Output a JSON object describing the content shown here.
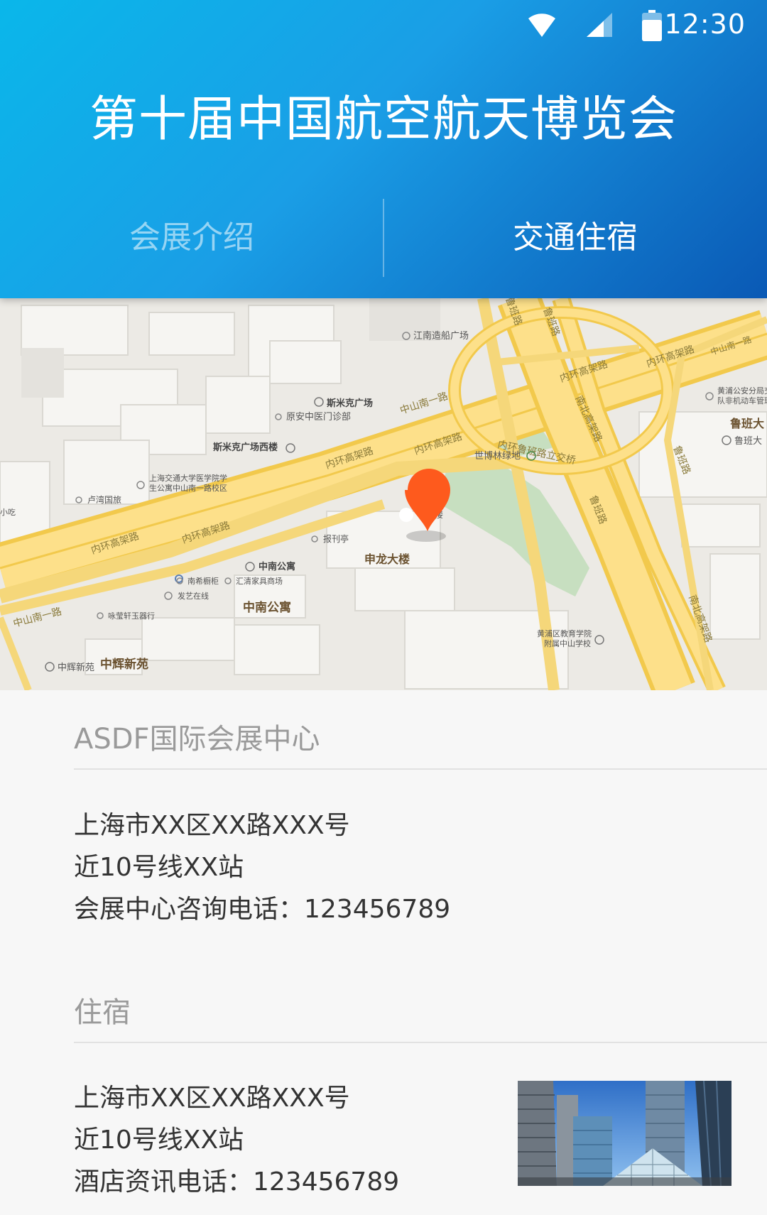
{
  "status_bar": {
    "time": "12:30",
    "icons": [
      "wifi-icon",
      "signal-icon",
      "battery-icon"
    ]
  },
  "header": {
    "title": "第十届中国航空航天博览会",
    "tabs": [
      {
        "label": "会展介绍",
        "active": false
      },
      {
        "label": "交通住宿",
        "active": true
      }
    ]
  },
  "map": {
    "marker_icon": "location-pin-icon",
    "marker_color": "#fe5a1d",
    "labels": {
      "a": "江南造船广场",
      "b": "斯米克广场",
      "c": "原安中医门诊部",
      "d": "斯米克广场西楼",
      "e": "上海交通大学医学院学",
      "e2": "生公寓中山南一路校区",
      "f": "卢湾国旅",
      "g": "小吃",
      "h": "报刊亭",
      "i": "中南公寓",
      "j": "南希橱柜",
      "k": "汇清家具商场",
      "l": "发艺在线",
      "m": "咏莹轩玉器行",
      "n": "中南公寓",
      "o": "中辉新苑",
      "p": "中辉新苑",
      "q": "申龙大楼",
      "q2": "大楼",
      "r": "世博林绿地",
      "s": "内环鲁班路立交桥",
      "t": "黄浦区教育学院",
      "t2": "附属中山学校",
      "u": "黄浦公安分局交",
      "u2": "队非机动车管理",
      "v": "鲁班大",
      "w": "鲁班大",
      "road_a": "中山南一路",
      "road_b": "中山南一路",
      "road_c": "中山南一路",
      "road_d": "内环高架路",
      "road_e": "内环高架路",
      "road_f": "内环高架路",
      "road_g": "内环高架路",
      "road_h": "内环高架路",
      "road_i": "内环高架路",
      "road_j": "南北高架路",
      "road_k": "南北高架路",
      "road_l": "鲁班路",
      "road_m": "鲁班路",
      "road_n": "鲁班路",
      "road_o": "鲁班路"
    }
  },
  "venue": {
    "title": "ASDF国际会展中心",
    "address": "上海市XX区XX路XXX号",
    "station": "近10号线XX站",
    "phone": "会展中心咨询电话：123456789"
  },
  "lodging": {
    "title": "住宿",
    "address": "上海市XX区XX路XXX号",
    "station": "近10号线XX站",
    "phone": "酒店资讯电话：123456789"
  }
}
